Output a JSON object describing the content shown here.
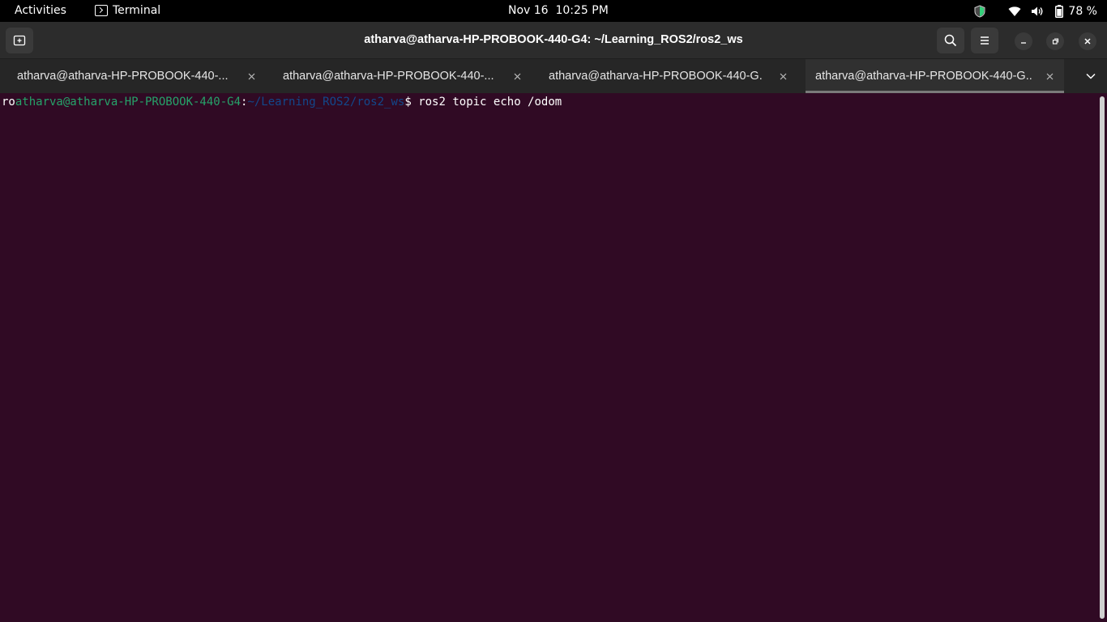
{
  "topbar": {
    "activities": "Activities",
    "app_name": "Terminal",
    "clock": "Nov 16  10:25 PM",
    "battery_percent": "78 %",
    "icons": [
      "shield-icon",
      "wifi-icon",
      "volume-icon",
      "battery-icon"
    ]
  },
  "window": {
    "title": "atharva@atharva-HP-PROBOOK-440-G4: ~/Learning_ROS2/ros2_ws",
    "buttons": [
      "new-tab-icon",
      "search-icon",
      "hamburger-menu-icon",
      "minimize-icon",
      "restore-icon",
      "close-icon"
    ]
  },
  "tabs": [
    {
      "label": "atharva@atharva-HP-PROBOOK-440-...",
      "active": false
    },
    {
      "label": "atharva@atharva-HP-PROBOOK-440-...",
      "active": false
    },
    {
      "label": "atharva@atharva-HP-PROBOOK-440-G...",
      "active": false
    },
    {
      "label": "atharva@atharva-HP-PROBOOK-440-G...",
      "active": true
    }
  ],
  "terminal": {
    "prefix": "ro",
    "user_host": "atharva@atharva-HP-PROBOOK-440-G4",
    "separator": ":",
    "path": "~/Learning_ROS2/ros2_ws",
    "prompt_symbol": "$",
    "command": " ros2 topic echo /odom"
  },
  "colors": {
    "terminal_bg": "#300a24",
    "prompt_user": "#26a269",
    "prompt_path": "#12488b",
    "text": "#ffffff"
  }
}
